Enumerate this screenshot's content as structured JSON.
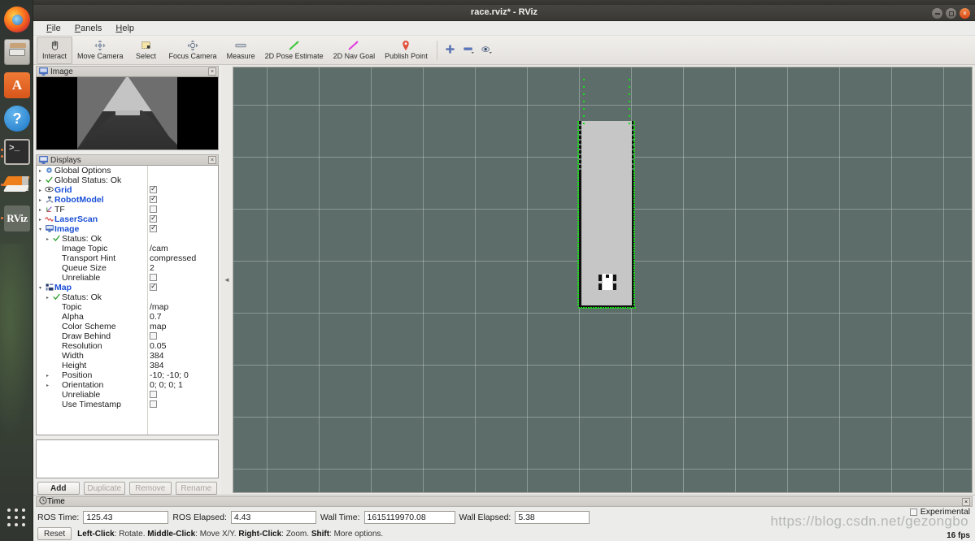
{
  "window": {
    "title": "race.rviz* - RViz",
    "controls": {
      "minimize": "–",
      "maximize": "□",
      "close": "×"
    }
  },
  "menubar": {
    "items": [
      "File",
      "Panels",
      "Help"
    ]
  },
  "toolbar": {
    "tools": [
      {
        "label": "Interact",
        "icon": "hand-icon",
        "active": true
      },
      {
        "label": "Move Camera",
        "icon": "move-camera-icon",
        "active": false
      },
      {
        "label": "Select",
        "icon": "select-rect-icon",
        "active": false
      },
      {
        "label": "Focus Camera",
        "icon": "focus-camera-icon",
        "active": false
      },
      {
        "label": "Measure",
        "icon": "measure-icon",
        "active": false
      },
      {
        "label": "2D Pose Estimate",
        "icon": "pose-estimate-icon",
        "active": false
      },
      {
        "label": "2D Nav Goal",
        "icon": "nav-goal-icon",
        "active": false
      },
      {
        "label": "Publish Point",
        "icon": "publish-point-icon",
        "active": false
      }
    ],
    "mini": [
      {
        "icon": "plus-icon"
      },
      {
        "icon": "minus-icon"
      },
      {
        "icon": "tool-properties-icon"
      }
    ]
  },
  "image_panel": {
    "title": "Image",
    "close": "×"
  },
  "displays_panel": {
    "title": "Displays",
    "close": "×",
    "rows": [
      {
        "indent": 0,
        "arrow": "▸",
        "icon": "gear-icon",
        "label": "Global Options",
        "link": false,
        "value": "",
        "checkbox": null
      },
      {
        "indent": 0,
        "arrow": "▸",
        "icon": "check-icon",
        "label": "Global Status: Ok",
        "link": false,
        "value": "",
        "checkbox": null
      },
      {
        "indent": 0,
        "arrow": "▸",
        "icon": "eye-icon",
        "label": "Grid",
        "link": true,
        "value": "",
        "checkbox": true
      },
      {
        "indent": 0,
        "arrow": "▸",
        "icon": "robot-icon",
        "label": "RobotModel",
        "link": true,
        "value": "",
        "checkbox": true
      },
      {
        "indent": 0,
        "arrow": "▸",
        "icon": "tf-axes-icon",
        "label": "TF",
        "link": false,
        "value": "",
        "checkbox": false
      },
      {
        "indent": 0,
        "arrow": "▸",
        "icon": "laserscan-icon",
        "label": "LaserScan",
        "link": true,
        "value": "",
        "checkbox": true
      },
      {
        "indent": 0,
        "arrow": "▾",
        "icon": "image-icon",
        "label": "Image",
        "link": true,
        "value": "",
        "checkbox": true
      },
      {
        "indent": 1,
        "arrow": "▸",
        "icon": "check-icon",
        "label": "Status: Ok",
        "link": false,
        "value": "",
        "checkbox": null
      },
      {
        "indent": 1,
        "arrow": "",
        "icon": "",
        "label": "Image Topic",
        "link": false,
        "value": "/cam",
        "checkbox": null
      },
      {
        "indent": 1,
        "arrow": "",
        "icon": "",
        "label": "Transport Hint",
        "link": false,
        "value": "compressed",
        "checkbox": null
      },
      {
        "indent": 1,
        "arrow": "",
        "icon": "",
        "label": "Queue Size",
        "link": false,
        "value": "2",
        "checkbox": null
      },
      {
        "indent": 1,
        "arrow": "",
        "icon": "",
        "label": "Unreliable",
        "link": false,
        "value": "",
        "checkbox": false
      },
      {
        "indent": 0,
        "arrow": "▾",
        "icon": "map-icon",
        "label": "Map",
        "link": true,
        "value": "",
        "checkbox": true
      },
      {
        "indent": 1,
        "arrow": "▸",
        "icon": "check-icon",
        "label": "Status: Ok",
        "link": false,
        "value": "",
        "checkbox": null
      },
      {
        "indent": 1,
        "arrow": "",
        "icon": "",
        "label": "Topic",
        "link": false,
        "value": "/map",
        "checkbox": null
      },
      {
        "indent": 1,
        "arrow": "",
        "icon": "",
        "label": "Alpha",
        "link": false,
        "value": "0.7",
        "checkbox": null
      },
      {
        "indent": 1,
        "arrow": "",
        "icon": "",
        "label": "Color Scheme",
        "link": false,
        "value": "map",
        "checkbox": null
      },
      {
        "indent": 1,
        "arrow": "",
        "icon": "",
        "label": "Draw Behind",
        "link": false,
        "value": "",
        "checkbox": false
      },
      {
        "indent": 1,
        "arrow": "",
        "icon": "",
        "label": "Resolution",
        "link": false,
        "value": "0.05",
        "checkbox": null
      },
      {
        "indent": 1,
        "arrow": "",
        "icon": "",
        "label": "Width",
        "link": false,
        "value": "384",
        "checkbox": null
      },
      {
        "indent": 1,
        "arrow": "",
        "icon": "",
        "label": "Height",
        "link": false,
        "value": "384",
        "checkbox": null
      },
      {
        "indent": 1,
        "arrow": "▸",
        "icon": "",
        "label": "Position",
        "link": false,
        "value": "-10; -10; 0",
        "checkbox": null
      },
      {
        "indent": 1,
        "arrow": "▸",
        "icon": "",
        "label": "Orientation",
        "link": false,
        "value": "0; 0; 0; 1",
        "checkbox": null
      },
      {
        "indent": 1,
        "arrow": "",
        "icon": "",
        "label": "Unreliable",
        "link": false,
        "value": "",
        "checkbox": false
      },
      {
        "indent": 1,
        "arrow": "",
        "icon": "",
        "label": "Use Timestamp",
        "link": false,
        "value": "",
        "checkbox": false
      }
    ],
    "buttons": [
      {
        "label": "Add",
        "enabled": true
      },
      {
        "label": "Duplicate",
        "enabled": false
      },
      {
        "label": "Remove",
        "enabled": false
      },
      {
        "label": "Rename",
        "enabled": false
      }
    ]
  },
  "time_panel": {
    "title": "Time",
    "close": "×",
    "fields": [
      {
        "label": "ROS Time:",
        "value": "125.43"
      },
      {
        "label": "ROS Elapsed:",
        "value": "4.43"
      },
      {
        "label": "Wall Time:",
        "value": "1615119970.08"
      },
      {
        "label": "Wall Elapsed:",
        "value": "5.38"
      }
    ],
    "reset_label": "Reset",
    "hints": [
      {
        "key": "Left-Click",
        "text": ": Rotate. "
      },
      {
        "key": "Middle-Click",
        "text": ": Move X/Y. "
      },
      {
        "key": "Right-Click",
        "text": ": Zoom. "
      },
      {
        "key": "Shift",
        "text": ": More options."
      }
    ],
    "experimental_label": "Experimental",
    "experimental_checked": false,
    "fps": "16 fps"
  },
  "launcher": {
    "items": [
      {
        "name": "firefox-icon",
        "label": "Firefox"
      },
      {
        "name": "files-icon",
        "label": "Files"
      },
      {
        "name": "software-icon",
        "label": "A"
      },
      {
        "name": "help-icon",
        "label": "?"
      },
      {
        "name": "terminal-icon",
        "label": ">_"
      },
      {
        "name": "books-icon",
        "label": ""
      },
      {
        "name": "rviz-icon",
        "label": "RViz"
      }
    ]
  },
  "watermark": {
    "text": "https://blog.csdn.net/gezongbo"
  },
  "viewport": {
    "background_color": "#5d6d6a",
    "grid_color": "#cddcd7",
    "map_free_color": "#c6c6c6",
    "map_wall_color": "#111111",
    "laserscan_color": "#18e018",
    "robot_color": "#ffffff"
  }
}
